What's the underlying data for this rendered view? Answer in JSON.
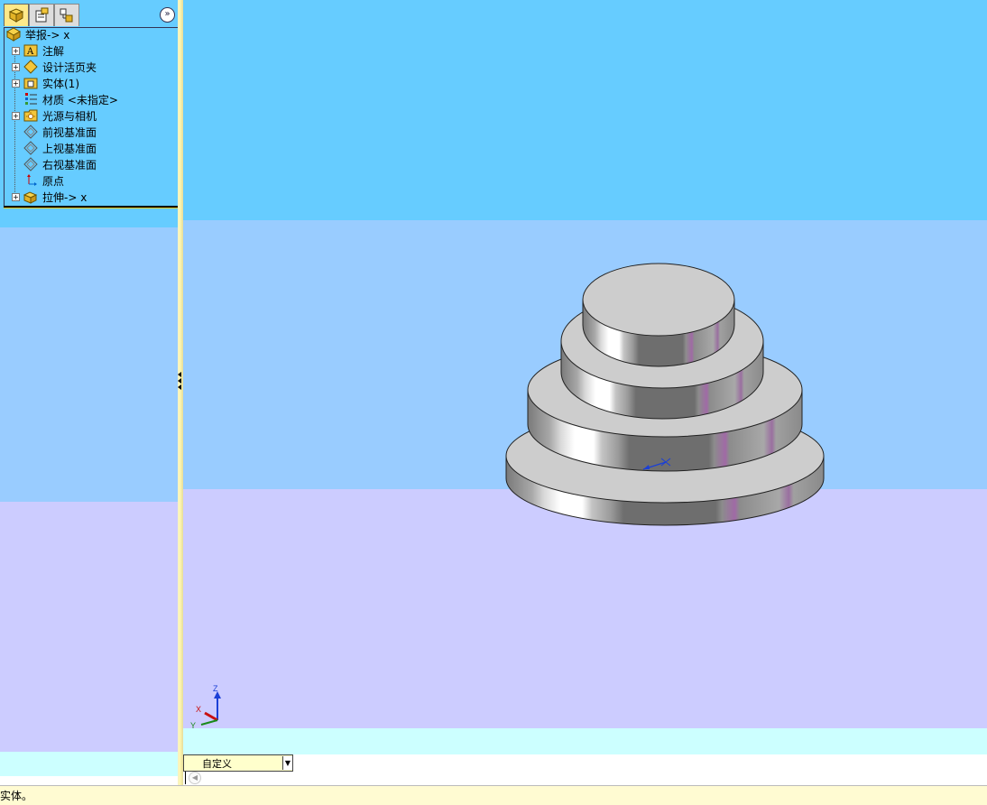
{
  "feature_manager": {
    "tabs": [
      {
        "name": "feature-manager-tab",
        "icon": "feature-tree-icon",
        "active": true
      },
      {
        "name": "property-manager-tab",
        "icon": "property-manager-icon",
        "active": false
      },
      {
        "name": "configuration-manager-tab",
        "icon": "configuration-manager-icon",
        "active": false
      }
    ],
    "collapse_icon": "»",
    "tree": {
      "root": {
        "label": "举报-> x",
        "icon": "part-icon"
      },
      "items": [
        {
          "label": "注解",
          "icon": "annotations-icon",
          "expandable": true
        },
        {
          "label": "设计活页夹",
          "icon": "design-binder-icon",
          "expandable": true
        },
        {
          "label": "实体(1)",
          "icon": "solid-bodies-icon",
          "expandable": true
        },
        {
          "label": "材质 <未指定>",
          "icon": "material-icon",
          "expandable": false
        },
        {
          "label": "光源与相机",
          "icon": "lights-cameras-icon",
          "expandable": true
        },
        {
          "label": "前视基准面",
          "icon": "plane-icon",
          "expandable": false
        },
        {
          "label": "上视基准面",
          "icon": "plane-icon",
          "expandable": false
        },
        {
          "label": "右视基准面",
          "icon": "plane-icon",
          "expandable": false
        },
        {
          "label": "原点",
          "icon": "origin-icon",
          "expandable": false
        },
        {
          "label": "拉伸-> x",
          "icon": "extrude-icon",
          "expandable": true
        }
      ]
    }
  },
  "viewport": {
    "background_colors": [
      "#66CCFF",
      "#99CCFF",
      "#CCCCFF",
      "#CCFFFF"
    ],
    "model": "stepped-cylinder-4-tiers",
    "triad": {
      "x_label": "X",
      "y_label": "Y",
      "z_label": "Z"
    }
  },
  "view_dropdown": {
    "value": "自定义",
    "arrow": "▼"
  },
  "sheet_nav": {
    "prev_icon": "◀"
  },
  "status_bar": {
    "text": "实体。"
  }
}
